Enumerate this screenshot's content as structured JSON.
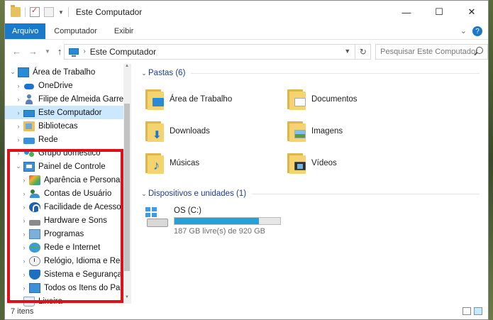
{
  "window": {
    "title": "Este Computador"
  },
  "ribbon": {
    "tabs": [
      "Arquivo",
      "Computador",
      "Exibir"
    ]
  },
  "address": {
    "path": "Este Computador",
    "search_placeholder": "Pesquisar Este Computador"
  },
  "sidebar": {
    "items": [
      {
        "label": "Área de Trabalho",
        "icon": "desktop-icon",
        "level": 0,
        "expander": "down"
      },
      {
        "label": "OneDrive",
        "icon": "onedrive-icon",
        "level": 1,
        "expander": "right"
      },
      {
        "label": "Filipe de Almeida Garrett",
        "icon": "user-icon",
        "level": 1,
        "expander": "right"
      },
      {
        "label": "Este Computador",
        "icon": "computer-icon",
        "level": 1,
        "expander": "right",
        "selected": true
      },
      {
        "label": "Bibliotecas",
        "icon": "libraries-icon",
        "level": 1,
        "expander": "right"
      },
      {
        "label": "Rede",
        "icon": "network-icon",
        "level": 1,
        "expander": "right"
      },
      {
        "label": "Grupo doméstico",
        "icon": "homegroup-icon",
        "level": 1,
        "expander": "right"
      },
      {
        "label": "Painel de Controle",
        "icon": "control-panel-icon",
        "level": 1,
        "expander": "down"
      },
      {
        "label": "Aparência e Personalização",
        "icon": "appearance-icon",
        "level": 2,
        "expander": "right"
      },
      {
        "label": "Contas de Usuário",
        "icon": "user-accounts-icon",
        "level": 2,
        "expander": "right"
      },
      {
        "label": "Facilidade de Acesso",
        "icon": "ease-of-access-icon",
        "level": 2,
        "expander": "right"
      },
      {
        "label": "Hardware e Sons",
        "icon": "hardware-icon",
        "level": 2,
        "expander": "right"
      },
      {
        "label": "Programas",
        "icon": "programs-icon",
        "level": 2,
        "expander": "right"
      },
      {
        "label": "Rede e Internet",
        "icon": "network-internet-icon",
        "level": 2,
        "expander": "right"
      },
      {
        "label": "Relógio, Idioma e Região",
        "icon": "clock-icon",
        "level": 2,
        "expander": "right"
      },
      {
        "label": "Sistema e Segurança",
        "icon": "security-icon",
        "level": 2,
        "expander": "right"
      },
      {
        "label": "Todos os Itens do Painel de",
        "icon": "all-items-icon",
        "level": 2,
        "expander": "right"
      },
      {
        "label": "Lixeira",
        "icon": "recycle-bin-icon",
        "level": 1,
        "expander": "none"
      }
    ]
  },
  "main": {
    "folders_header": "Pastas (6)",
    "folders": [
      {
        "label": "Área de Trabalho",
        "overlay": "desktop"
      },
      {
        "label": "Documentos",
        "overlay": "docs"
      },
      {
        "label": "Downloads",
        "overlay": "down"
      },
      {
        "label": "Imagens",
        "overlay": "img"
      },
      {
        "label": "Músicas",
        "overlay": "music"
      },
      {
        "label": "Vídeos",
        "overlay": "vid"
      }
    ],
    "devices_header": "Dispositivos e unidades (1)",
    "drive": {
      "name": "OS (C:)",
      "free_text": "187 GB livre(s) de 920 GB",
      "used_fraction": 0.797
    }
  },
  "status": {
    "items_count": "7 itens"
  },
  "colors": {
    "accent": "#1979ca",
    "selection": "#cce8ff",
    "highlight_box": "#e0101b",
    "drive_bar": "#26a0da"
  }
}
